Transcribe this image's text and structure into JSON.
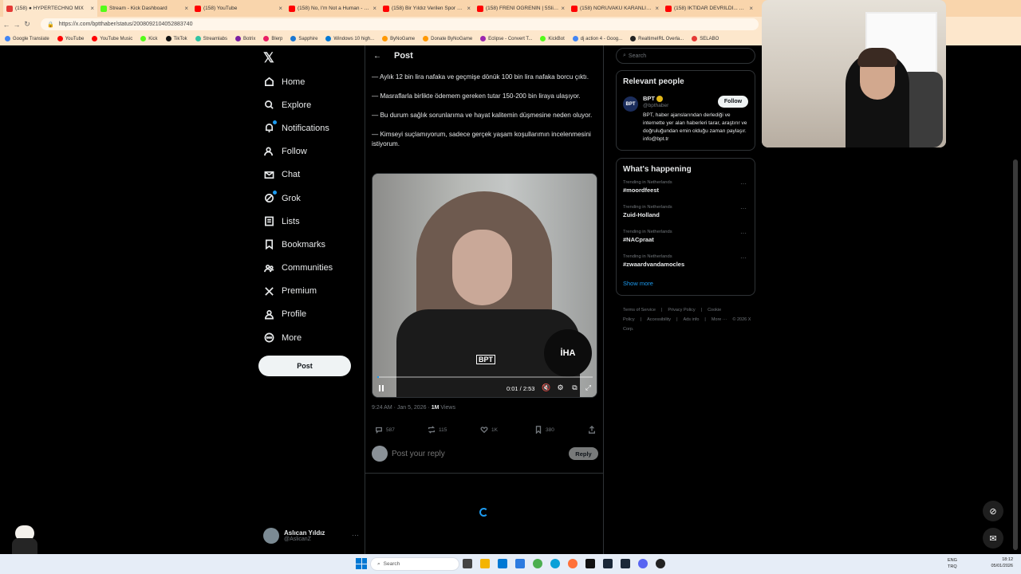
{
  "browser": {
    "tabs": [
      {
        "label": "(158) ● HYPERTECHNO MIX",
        "color": "#e53935"
      },
      {
        "label": "Stream - Kick Dashboard",
        "color": "#53fc18"
      },
      {
        "label": "(158) YouTube",
        "color": "#ff0000"
      },
      {
        "label": "(158) No, I'm Not a Human - Offic",
        "color": "#ff0000"
      },
      {
        "label": "(158) Bir Yıldız Verilen Spor Salonl",
        "color": "#ff0000"
      },
      {
        "label": "(158) FRENİ ÖĞRENİN | 5Sliders |",
        "color": "#ff0000"
      },
      {
        "label": "(158) NORUVAKU KARANLIK YÜZ:",
        "color": "#ff0000"
      },
      {
        "label": "(158) İKTİDAR DEVRİLDİ... YouT",
        "color": "#ff0000"
      }
    ],
    "url": "https://x.com/bptthaber/status/2008092104052883740",
    "bookmarks": [
      {
        "label": "Google Translate",
        "color": "#4285f4"
      },
      {
        "label": "YouTube",
        "color": "#ff0000"
      },
      {
        "label": "YouTube Music",
        "color": "#ff0000"
      },
      {
        "label": "Kick",
        "color": "#53fc18"
      },
      {
        "label": "TikTok",
        "color": "#111111"
      },
      {
        "label": "Streamlabs",
        "color": "#31c3a2"
      },
      {
        "label": "Botrix",
        "color": "#7b1fa2"
      },
      {
        "label": "Blerp",
        "color": "#e91e63"
      },
      {
        "label": "Sapphire",
        "color": "#1976d2"
      },
      {
        "label": "Windows 10 high...",
        "color": "#0078d4"
      },
      {
        "label": "ByNoGame",
        "color": "#ff9800"
      },
      {
        "label": "Donate ByNoGame",
        "color": "#ff9800"
      },
      {
        "label": "Eclipse - Convert T...",
        "color": "#9c27b0"
      },
      {
        "label": "KickBot",
        "color": "#53fc18"
      },
      {
        "label": "dj action 4 - Goog...",
        "color": "#4285f4"
      },
      {
        "label": "RealtimeIRL Overla...",
        "color": "#222222"
      },
      {
        "label": "SELABO",
        "color": "#e53935"
      }
    ]
  },
  "sidebar": {
    "logo": "𝕏",
    "items": [
      {
        "label": "Home",
        "icon": "home-icon"
      },
      {
        "label": "Explore",
        "icon": "search-icon"
      },
      {
        "label": "Notifications",
        "icon": "bell-icon"
      },
      {
        "label": "Follow",
        "icon": "person-add-icon"
      },
      {
        "label": "Chat",
        "icon": "mail-icon"
      },
      {
        "label": "Grok",
        "icon": "grok-icon"
      },
      {
        "label": "Lists",
        "icon": "list-icon"
      },
      {
        "label": "Bookmarks",
        "icon": "bookmark-icon"
      },
      {
        "label": "Communities",
        "icon": "communities-icon"
      },
      {
        "label": "Premium",
        "icon": "x-logo-icon"
      },
      {
        "label": "Profile",
        "icon": "profile-icon"
      },
      {
        "label": "More",
        "icon": "more-circle-icon"
      }
    ],
    "post_button": "Post",
    "account": {
      "name": "Aslıcan Yıldız",
      "handle": "@AslicanZ"
    }
  },
  "post": {
    "header_title": "Post",
    "paragraphs": [
      "— Aylık 12 bin lira nafaka ve geçmişe dönük 100 bin lira nafaka borcu çıktı.",
      "— Masraflarla birlikte ödemem gereken tutar 150-200 bin liraya ulaşıyor.",
      "— Bu durum sağlık sorunlarıma ve hayat kalitemin düşmesine neden oluyor.",
      "— Kimseyi suçlamıyorum, sadece gerçek yaşam koşullarımın incelenmesini istiyorum."
    ],
    "video": {
      "time": "0:01 / 2:53",
      "progress": 0.006,
      "logo_bpt": "BPT",
      "logo_iha": "İHA"
    },
    "timestamp": "9:24 AM · Jan 5, 2026 · ",
    "views_count": "1M",
    "views_label": " Views",
    "stats": {
      "replies": "587",
      "reposts": "115",
      "likes": "1K",
      "bookmarks": "380"
    },
    "reply_placeholder": "Post your reply",
    "reply_button": "Reply"
  },
  "right": {
    "search_placeholder": "Search",
    "relevant_title": "Relevant people",
    "person": {
      "avatar_text": "BPT",
      "name": "BPT",
      "handle": "@bpthaber",
      "follow_label": "Follow",
      "bio": "BPT, haber ajanslarından derlediği ve internette yer alan haberleri tarar, araştırır ve doğruluğundan emin olduğu zaman paylaşır. info@bpt.tr"
    },
    "happening_title": "What's happening",
    "trends": [
      {
        "context": "Trending in Netherlands",
        "name": "#moordfeest"
      },
      {
        "context": "Trending in Netherlands",
        "name": "Zuid-Holland"
      },
      {
        "context": "Trending in Netherlands",
        "name": "#NACpraat"
      },
      {
        "context": "Trending in Netherlands",
        "name": "#zwaardvandamocles"
      }
    ],
    "show_more": "Show more",
    "footer": [
      "Terms of Service",
      "|",
      "Privacy Policy",
      "|",
      "Cookie Policy",
      "|",
      "Accessibility",
      "|",
      "Ads info",
      "|",
      "More ···",
      "© 2026 X Corp."
    ]
  },
  "taskbar": {
    "search_label": "Search",
    "lang": "ENG\nTRQ",
    "time": "18:12",
    "date": "05/01/2026"
  }
}
